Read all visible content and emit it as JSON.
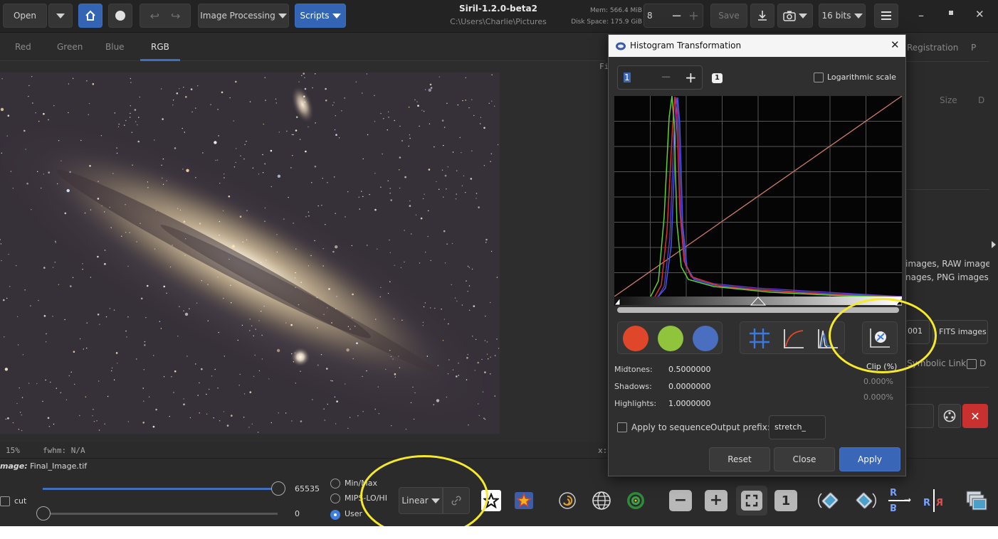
{
  "header": {
    "open_label": "Open",
    "image_processing_label": "Image Processing",
    "scripts_label": "Scripts",
    "app_title": "Siril-1.2.0-beta2",
    "working_dir": "C:\\Users\\Charlie\\Pictures",
    "mem_text": "Mem: 566.4 MiB",
    "disk_text": "Disk Space: 175.9 GiB",
    "threads_value": "8",
    "save_label": "Save",
    "bitdepth_label": "16 bits"
  },
  "tabs": [
    "Red",
    "Green",
    "Blue",
    "RGB"
  ],
  "active_tab": "RGB",
  "viewport": {
    "zoom_text": "15%",
    "fwhm_text": "fwhm: N/A",
    "fi_text": "Fi",
    "x_text": "x:"
  },
  "right_panel": {
    "registration_tab": "Registration",
    "p_tab": "P",
    "size_header": "Size",
    "d_header": "D",
    "formats_line1": "images, RAW images",
    "formats_line2": "nages, PNG images,",
    "digits_value": "001",
    "fits_label": "FITS images",
    "symbolic_link_label": "Symbolic Link"
  },
  "bottom": {
    "image_label_prefix": "mage:",
    "image_name": "Final_Image.tif",
    "max_value": "65535",
    "min_value": "0",
    "cut_label": "cut",
    "minmax_label": "Min/Max",
    "mips_label": "MIPS-LO/HI",
    "user_label": "User",
    "scale_mode": "Linear",
    "ruler_r_top": "R",
    "ruler_r_bottom": "B",
    "ruler_r_right": "R"
  },
  "dialog": {
    "title": "Histogram Transformation",
    "zoom_value": "1",
    "zoom_badge": "1",
    "log_scale_label": "Logarithmic scale",
    "clip_label": "Clip (%)",
    "midtones_label": "Midtones:",
    "midtones_value": "0.5000000",
    "shadows_label": "Shadows:",
    "shadows_value": "0.0000000",
    "shadows_clip": "0.000%",
    "highlights_label": "Highlights:",
    "highlights_value": "1.0000000",
    "highlights_clip": "0.000%",
    "apply_sequence_label": "Apply to sequence",
    "output_prefix_label": "Output prefix:",
    "output_prefix_value": "stretch_",
    "reset_label": "Reset",
    "close_label": "Close",
    "apply_label": "Apply"
  },
  "colors": {
    "accent": "#3a66b8",
    "red_channel": "#e0472a",
    "green_channel": "#8fc43c",
    "blue_channel": "#4a6fc0",
    "annotation": "#f5e92a"
  }
}
